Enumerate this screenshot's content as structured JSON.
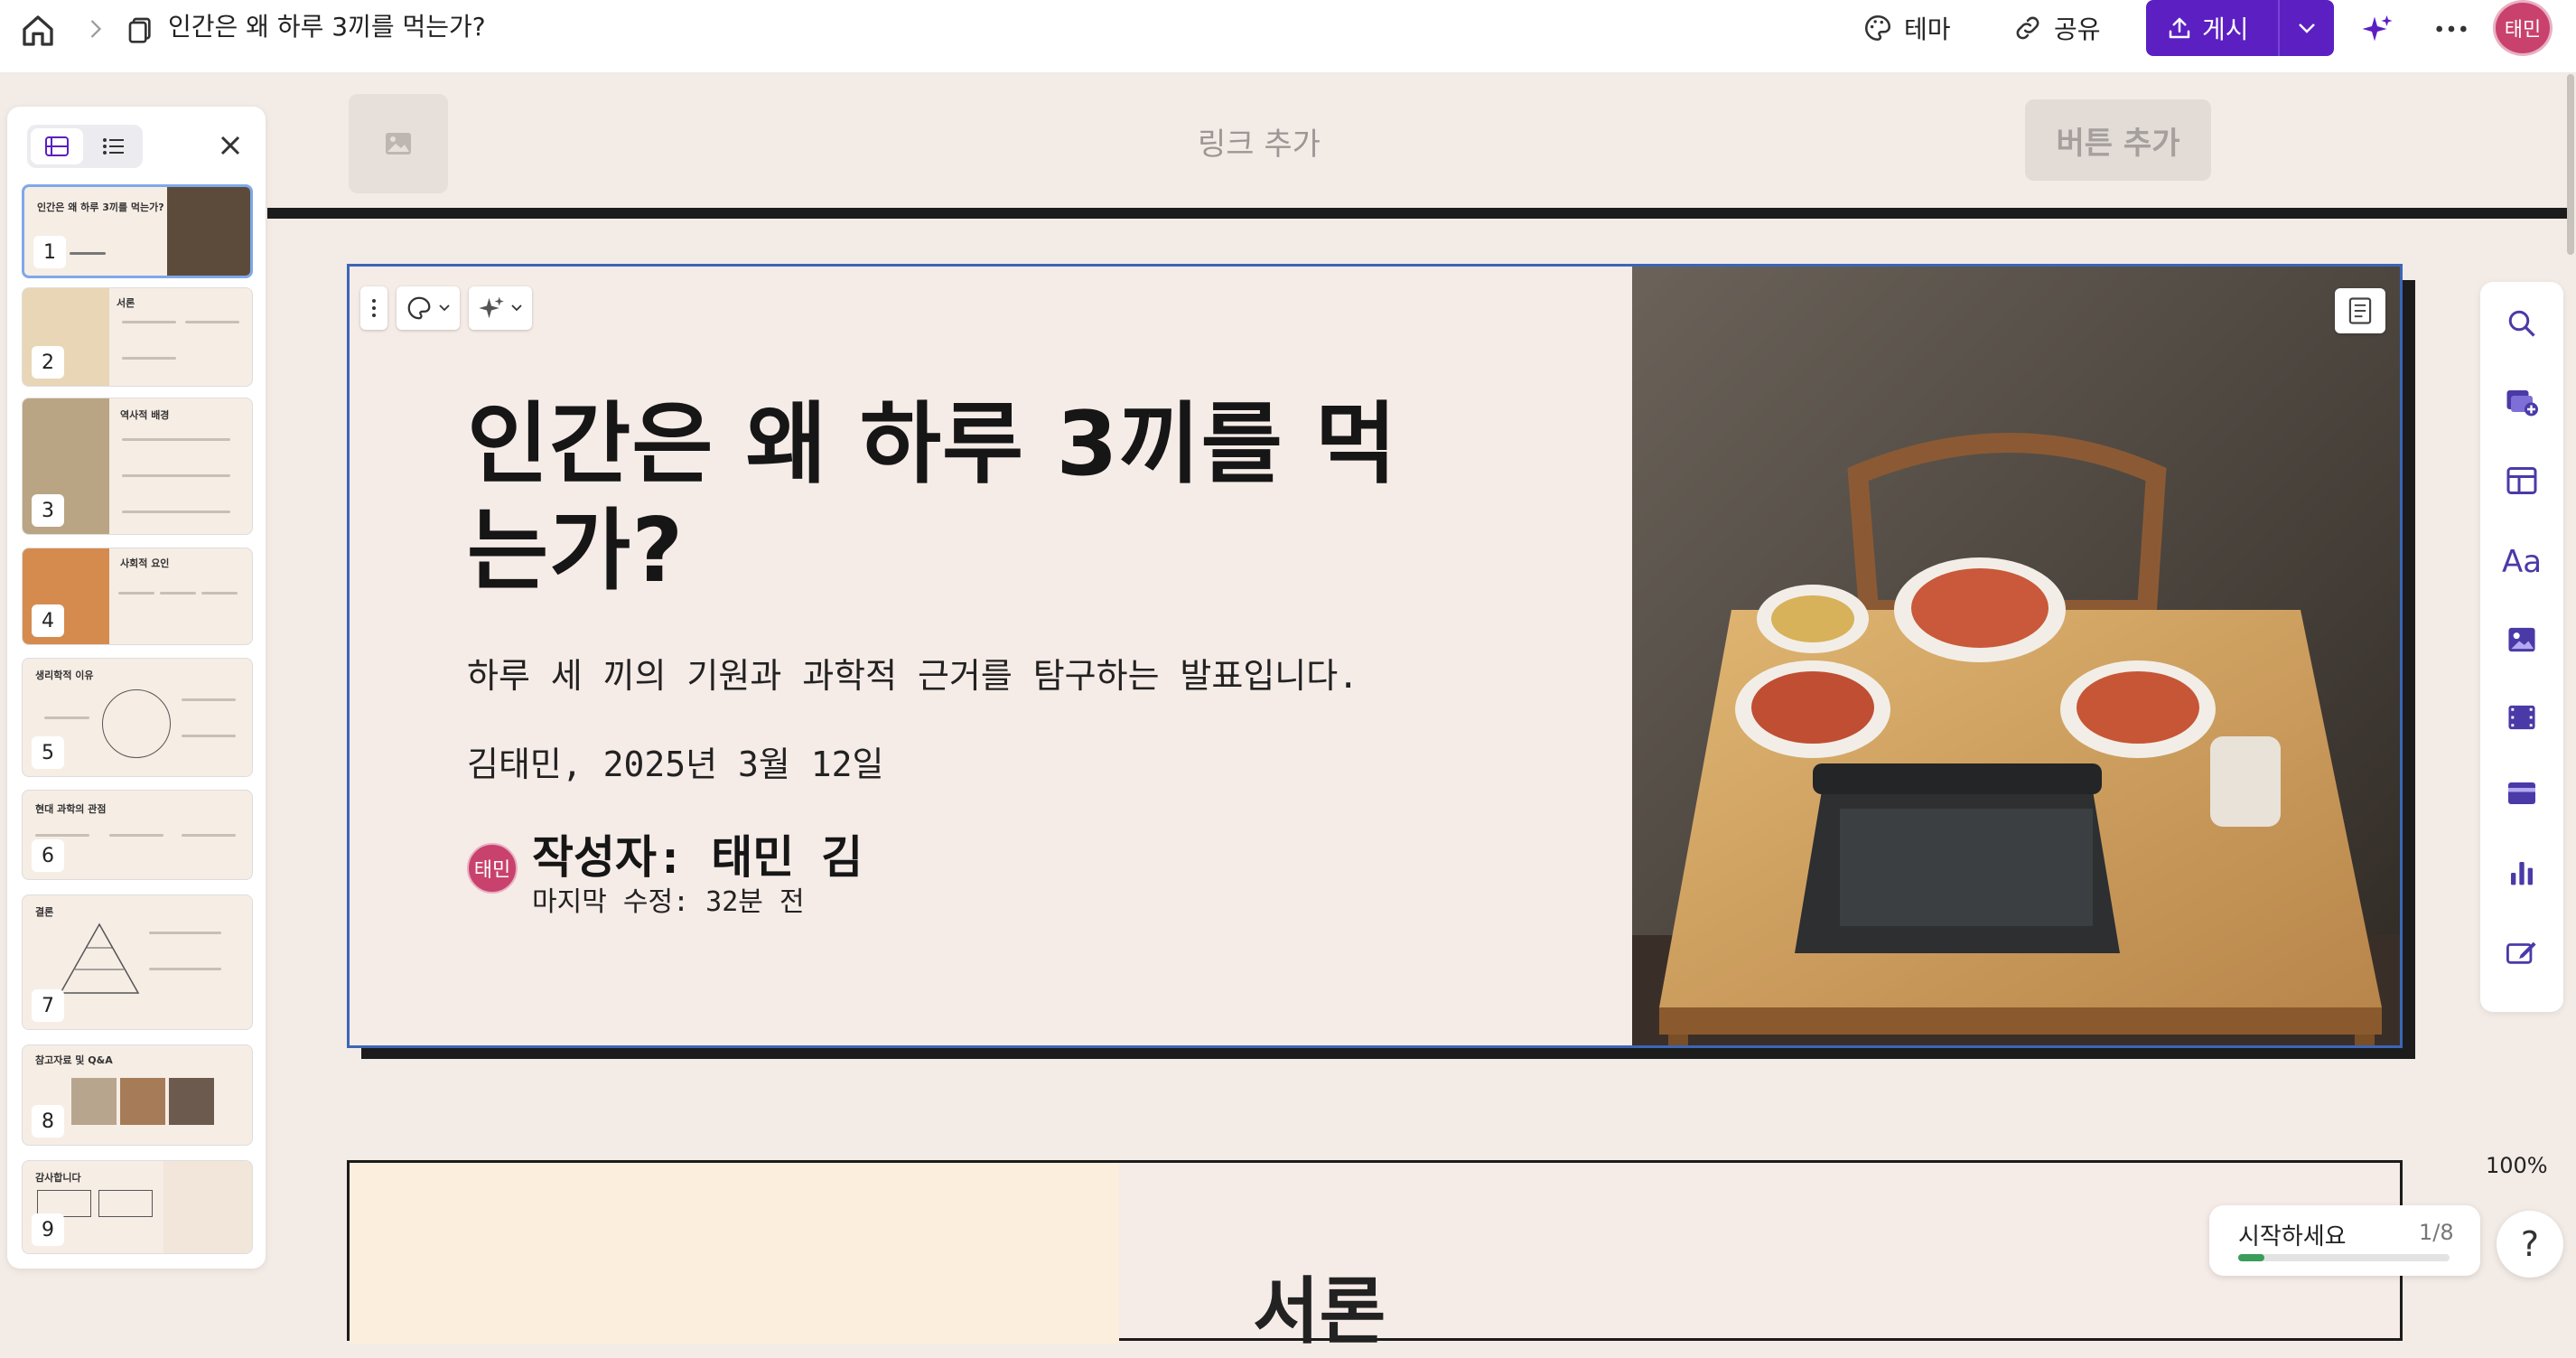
{
  "topbar": {
    "title": "인간은 왜 하루 3끼를 먹는가?",
    "theme_label": "테마",
    "share_label": "공유",
    "publish_label": "게시",
    "avatar_initials": "태민"
  },
  "thumbnails": {
    "view_modes": [
      "grid-icon",
      "list-icon"
    ],
    "slides": [
      {
        "number": "1",
        "title": "인간은 왜 하루 3끼를 먹는가?"
      },
      {
        "number": "2",
        "title": "서론"
      },
      {
        "number": "3",
        "title": "역사적 배경"
      },
      {
        "number": "4",
        "title": "사회적 요인"
      },
      {
        "number": "5",
        "title": "생리학적 이유"
      },
      {
        "number": "6",
        "title": "현대 과학의 관점"
      },
      {
        "number": "7",
        "title": "결론"
      },
      {
        "number": "8",
        "title": "참고자료 및 Q&A"
      },
      {
        "number": "9",
        "title": "감사합니다"
      }
    ]
  },
  "page_header": {
    "add_link": "링크 추가",
    "add_button": "버튼 추가"
  },
  "slide": {
    "title": "인간은 왜 하루 3끼를 먹는가?",
    "subtitle": "하루 세 끼의 기원과 과학적 근거를 탐구하는 발표입니다.",
    "date_line": "김태민, 2025년 3월 12일",
    "author_initials": "태민",
    "author_name": "작성자: 태민 김",
    "last_edited": "마지막 수정: 32분 전"
  },
  "next_slide": {
    "title": "서론"
  },
  "right_toolbar": [
    "search-icon",
    "add-card-icon",
    "layout-icon",
    "text-style-icon",
    "image-icon",
    "video-icon",
    "card-icon",
    "chart-icon",
    "edit-icon"
  ],
  "zoom": "100%",
  "get_started": {
    "label": "시작하세요",
    "count": "1/8",
    "progress": 0.125
  },
  "help": "?",
  "colors": {
    "accent": "#5b1fc2",
    "avatar": "#c8426d",
    "canvas_bg": "#f3ebe5",
    "slide_border": "#3a66b7"
  }
}
